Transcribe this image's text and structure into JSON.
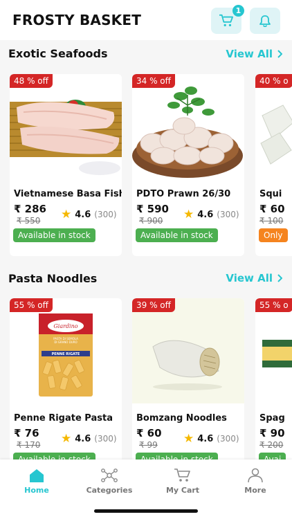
{
  "app": {
    "title": "FROSTY BASKET"
  },
  "header": {
    "cart_count": "1"
  },
  "sections": [
    {
      "title": "Exotic Seafoods",
      "view_all": "View All",
      "products": [
        {
          "discount": "48 % off",
          "name": "Vietnamese Basa Fish",
          "price": "₹ 286",
          "mrp": "₹ 550",
          "rating": "4.6",
          "count": "(300)",
          "stock": "Available in stock"
        },
        {
          "discount": "34 % off",
          "name": "PDTO Prawn 26/30",
          "price": "₹ 590",
          "mrp": "₹ 900",
          "rating": "4.6",
          "count": "(300)",
          "stock": "Available in stock"
        },
        {
          "discount": "40 % o",
          "name": "Squi",
          "price": "₹ 60",
          "mrp": "₹ 100",
          "stock": "Only"
        }
      ]
    },
    {
      "title": "Pasta Noodles",
      "view_all": "View All",
      "products": [
        {
          "discount": "55 % off",
          "name": "Penne Rigate Pasta",
          "price": "₹ 76",
          "mrp": "₹ 170",
          "rating": "4.6",
          "count": "(300)",
          "stock": "Available in stock"
        },
        {
          "discount": "39 % off",
          "name": "Bomzang Noodles",
          "price": "₹ 60",
          "mrp": "₹ 99",
          "rating": "4.6",
          "count": "(300)",
          "stock": "Available in stock"
        },
        {
          "discount": "55 % o",
          "name": "Spag",
          "price": "₹ 90",
          "mrp": "₹ 200",
          "stock": "Avai"
        }
      ]
    }
  ],
  "pasta_pack": {
    "brand": "Giardino",
    "line1": "PASTA DI SEMOLA",
    "line2": "DI GRANO DURO",
    "name": "PENNE RIGATE"
  },
  "tabs": [
    {
      "label": "Home",
      "icon": "home-icon"
    },
    {
      "label": "Categories",
      "icon": "categories-icon"
    },
    {
      "label": "My Cart",
      "icon": "cart-icon"
    },
    {
      "label": "More",
      "icon": "person-icon"
    }
  ],
  "colors": {
    "accent": "#26c6d0",
    "discount": "#d42626",
    "stock": "#4caf50",
    "star": "#f5b800"
  }
}
